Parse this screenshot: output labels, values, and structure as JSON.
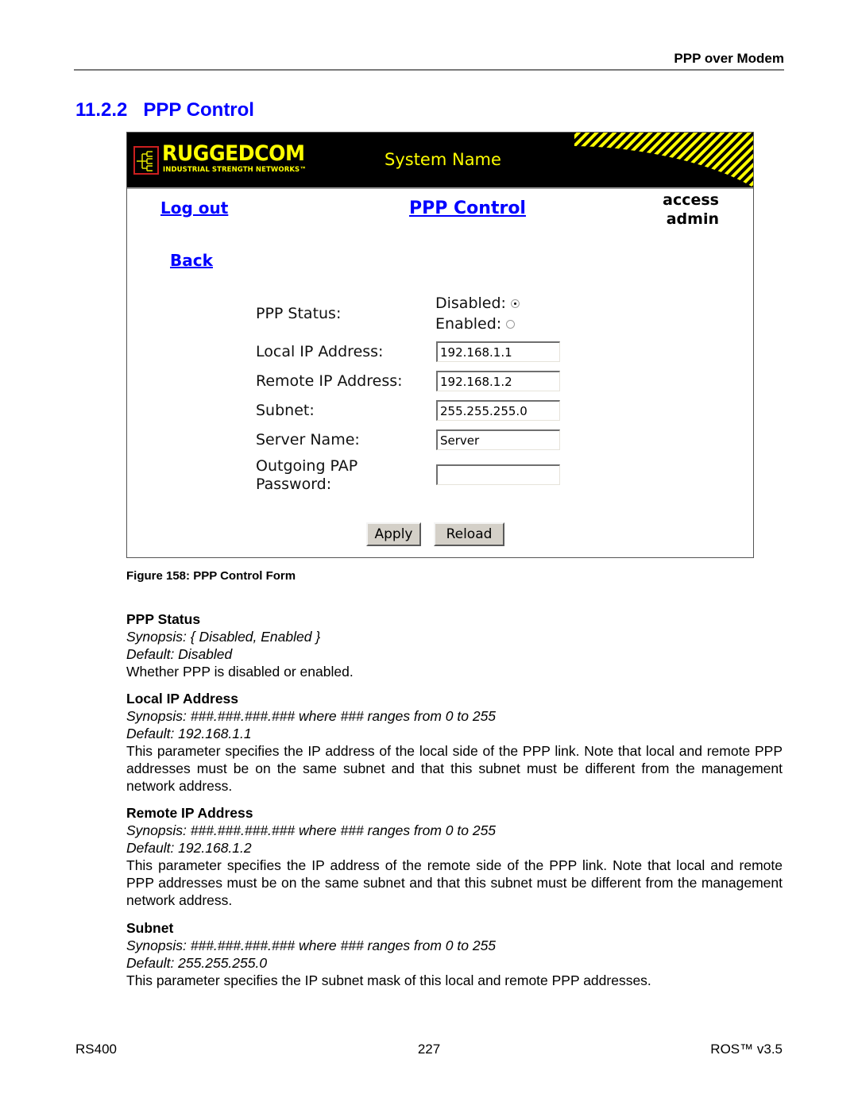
{
  "running_header": "PPP over Modem",
  "section": {
    "number": "11.2.2",
    "title": "PPP Control"
  },
  "figure": {
    "banner": {
      "brand": "RUGGEDCOM",
      "tagline": "INDUSTRIAL STRENGTH NETWORKS™",
      "system_name": "System Name",
      "colors": {
        "background": "#000000",
        "accent": "#ffff00",
        "logo_border": "#cc1f1f"
      }
    },
    "nav": {
      "logout": "Log out",
      "page_title": "PPP Control",
      "back": "Back",
      "access_label": "access",
      "access_level": "admin"
    },
    "form": {
      "ppp_status": {
        "label": "PPP Status:",
        "options": [
          {
            "label": "Disabled:",
            "checked": true
          },
          {
            "label": "Enabled:",
            "checked": false
          }
        ]
      },
      "local_ip": {
        "label": "Local IP Address:",
        "value": "192.168.1.1"
      },
      "remote_ip": {
        "label": "Remote IP Address:",
        "value": "192.168.1.2"
      },
      "subnet": {
        "label": "Subnet:",
        "value": "255.255.255.0"
      },
      "server_name": {
        "label": "Server Name:",
        "value": "Server"
      },
      "pap_password": {
        "label_line1": "Outgoing PAP",
        "label_line2": "Password:",
        "value": ""
      },
      "apply": "Apply",
      "reload": "Reload"
    },
    "caption": "Figure 158: PPP Control Form"
  },
  "parameters": [
    {
      "title": "PPP Status",
      "synopsis": "Synopsis: { Disabled, Enabled }",
      "default": "Default: Disabled",
      "description": "Whether PPP is disabled or enabled."
    },
    {
      "title": "Local IP Address",
      "synopsis": "Synopsis: ###.###.###.###  where ### ranges from 0 to 255",
      "default": "Default: 192.168.1.1",
      "description": "This parameter specifies the IP address of the local side of the PPP link. Note that local and remote PPP addresses must be on the same subnet and that this subnet must be different from the management network address."
    },
    {
      "title": "Remote IP Address",
      "synopsis": "Synopsis: ###.###.###.###  where ### ranges from 0 to 255",
      "default": "Default: 192.168.1.2",
      "description": "This parameter specifies the IP address of the remote side of the PPP link. Note that local and remote PPP addresses must be on the same subnet and that this subnet must be different from the management network address."
    },
    {
      "title": "Subnet",
      "synopsis": "Synopsis: ###.###.###.###  where ### ranges from 0 to 255",
      "default": "Default: 255.255.255.0",
      "description": "This parameter specifies the IP subnet mask of this local and remote PPP addresses."
    }
  ],
  "footer": {
    "left": "RS400",
    "center": "227",
    "right": "ROS™  v3.5"
  },
  "colors": {
    "heading": "#0000ff",
    "link": "#0000ff",
    "rule": "#7a7a7a",
    "button_face": "#d4d0c8"
  }
}
